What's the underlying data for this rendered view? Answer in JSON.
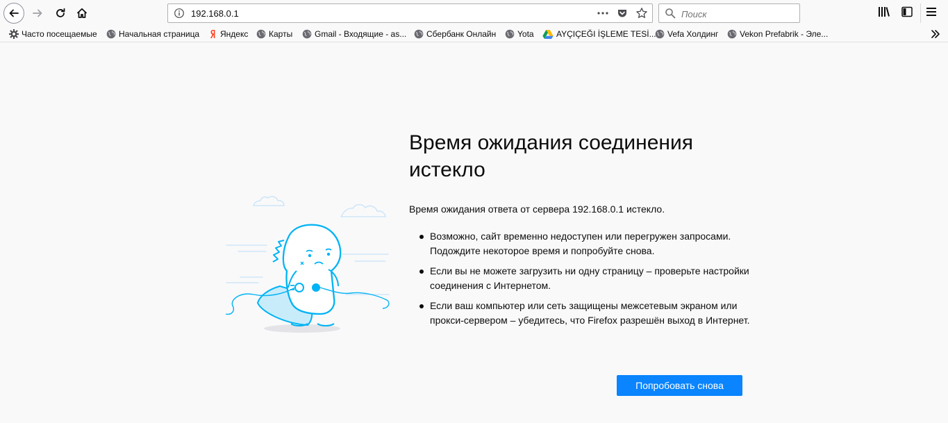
{
  "toolbar": {
    "back": "back-arrow",
    "forward": "forward-arrow",
    "reload": "reload",
    "home": "home",
    "url": "192.168.0.1",
    "page_actions": "•••",
    "search_placeholder": "Поиск"
  },
  "bookmarks": [
    {
      "label": "Часто посещаемые",
      "icon": "gear-icon"
    },
    {
      "label": "Начальная страница",
      "icon": "globe-icon"
    },
    {
      "label": "Яндекс",
      "icon": "yandex-icon"
    },
    {
      "label": "Карты",
      "icon": "globe-icon"
    },
    {
      "label": "Gmail - Входящие - as...",
      "icon": "globe-icon"
    },
    {
      "label": "Сбербанк Онлайн",
      "icon": "globe-icon"
    },
    {
      "label": "Yota",
      "icon": "globe-icon"
    },
    {
      "label": "AYÇIÇEĞI İŞLEME TESİ...",
      "icon": "drive-icon"
    },
    {
      "label": "Vefa Холдинг",
      "icon": "globe-icon"
    },
    {
      "label": "Vekon Prefabrik - Эле...",
      "icon": "globe-icon"
    }
  ],
  "error": {
    "title": "Время ожидания соединения истекло",
    "description": "Время ожидания ответа от сервера 192.168.0.1 истекло.",
    "items": [
      "Возможно, сайт временно недоступен или перегружен запросами. Подождите некоторое время и попробуйте снова.",
      "Если вы не можете загрузить ни одну страницу – проверьте настройки соединения с Интернетом.",
      "Если ваш компьютер или сеть защищены межсетевым экраном или прокси-сервером – убедитесь, что Firefox разрешён выход в Интернет."
    ],
    "button": "Попробовать снова"
  },
  "colors": {
    "accent": "#0a84ff",
    "page_bg": "#f9f9fa",
    "dino": "#00b3f4"
  }
}
